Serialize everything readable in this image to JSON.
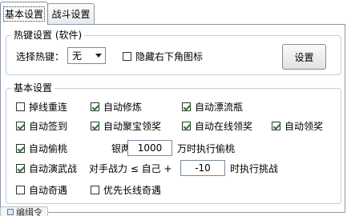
{
  "tabs": [
    {
      "label": "基本设置",
      "active": true
    },
    {
      "label": "战斗设置",
      "active": false
    }
  ],
  "hotkey_group": {
    "legend": "热键设置 (软件)",
    "select_label": "选择热键：",
    "select_value": "无",
    "hide_tray_label": "隐藏右下角图标",
    "hide_tray_checked": false,
    "set_button": "设置"
  },
  "basic_group": {
    "legend": "基本设置",
    "options": {
      "reconnect": {
        "label": "掉线重连",
        "checked": false
      },
      "auto_cultivate": {
        "label": "自动修炼",
        "checked": true
      },
      "auto_drift_bottle": {
        "label": "自动漂流瓶",
        "checked": true
      },
      "auto_signin": {
        "label": "自动签到",
        "checked": true
      },
      "auto_treasure": {
        "label": "自动聚宝领奖",
        "checked": true
      },
      "auto_online_reward": {
        "label": "自动在线领奖",
        "checked": true
      },
      "auto_claim": {
        "label": "自动领奖",
        "checked": true
      },
      "auto_steal_peach": {
        "label": "自动偷桃",
        "checked": true
      },
      "auto_martial": {
        "label": "自动演武战",
        "checked": true
      },
      "auto_adventure": {
        "label": "自动奇遇",
        "checked": false
      },
      "prefer_long_adventure": {
        "label": "优先长线奇遇",
        "checked": false
      }
    },
    "peach_rule": {
      "prefix": "银两 ≥",
      "value": "1000",
      "suffix": "万时执行偷桃"
    },
    "battle_rule": {
      "prefix": "对手战力 ≤ 自己 +",
      "value": "-10",
      "suffix": "时执行挑战"
    }
  },
  "bottom_tab": {
    "label": "编缉令"
  }
}
